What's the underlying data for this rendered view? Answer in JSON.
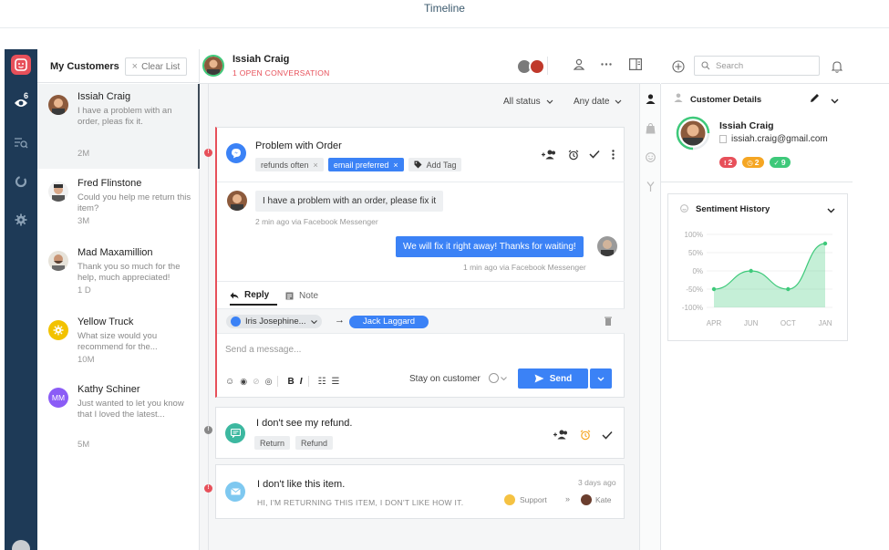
{
  "caption": "Timeline",
  "customers": {
    "title": "My Customers",
    "clear_label": "Clear List",
    "items": [
      {
        "name": "Issiah Craig",
        "message": "I have a problem with an order, pleas fix it.",
        "time": "2M"
      },
      {
        "name": "Fred Flinstone",
        "message": "Could you help me return this item?",
        "time": "3M"
      },
      {
        "name": "Mad Maxamillion",
        "message": "Thank you so much for the help, much appreciated!",
        "time": "1 D"
      },
      {
        "name": "Yellow Truck",
        "message": "What size would you recommend for the...",
        "time": "10M"
      },
      {
        "name": "Kathy Schiner",
        "initials": "MM",
        "message": "Just wanted to let you know that I loved the latest...",
        "time": "5M"
      }
    ]
  },
  "nav": {
    "badge": "6"
  },
  "header": {
    "name": "Issiah Craig",
    "subtitle": "1 OPEN CONVERSATION"
  },
  "filters": {
    "status": "All status",
    "date": "Any date"
  },
  "conversation": {
    "title": "Problem with Order",
    "tags": [
      "refunds often",
      "email preferred"
    ],
    "add_tag": "Add Tag",
    "msg_in": "I have a problem with an order, please fix it",
    "msg_in_meta": "2 min ago via Facebook Messenger",
    "msg_out": "We will fix it right away! Thanks for waiting!",
    "msg_out_meta": "1 min ago via Facebook Messenger",
    "tab_reply": "Reply",
    "tab_note": "Note",
    "from": "Iris Josephine...",
    "to": "Jack Laggard",
    "placeholder": "Send a message...",
    "stay_label": "Stay on customer",
    "send_label": "Send"
  },
  "conv2": {
    "title": "I don't see my refund.",
    "tags": [
      "Return",
      "Refund"
    ]
  },
  "conv3": {
    "title": "I don't like this item.",
    "preview": "HI, I'M RETURNING THIS ITEM, I DON'T LIKE HOW IT.",
    "time": "3 days ago",
    "support": "Support",
    "agent": "Kate"
  },
  "search": {
    "placeholder": "Search"
  },
  "details": {
    "title": "Customer Details",
    "name": "Issiah Craig",
    "email": "issiah.craig@gmail.com",
    "pills": [
      {
        "value": "2",
        "color": "#e7505a"
      },
      {
        "value": "2",
        "color": "#f5a623"
      },
      {
        "value": "9",
        "color": "#3ec97a"
      }
    ]
  },
  "chart_data": {
    "type": "area",
    "title": "Sentiment History",
    "categories": [
      "APR",
      "JUN",
      "OCT",
      "JAN"
    ],
    "y_ticks": [
      "100%",
      "50%",
      "0%",
      "-50%",
      "-100%"
    ],
    "ylim": [
      -100,
      100
    ],
    "values": [
      -50,
      0,
      -50,
      75
    ],
    "color": "#3ec97a"
  }
}
